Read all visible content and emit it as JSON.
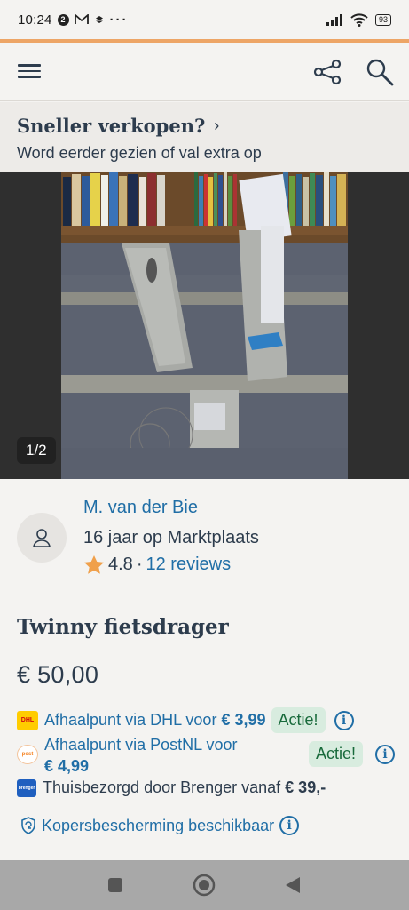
{
  "status": {
    "time": "10:24",
    "notif_count": "2",
    "battery": "93"
  },
  "colors": {
    "accent": "#eda566",
    "link": "#206ea6",
    "text": "#2d3c4d",
    "badge_bg": "#d8ecdf",
    "badge_text": "#186a3b",
    "star": "#f0a04b"
  },
  "promo": {
    "title": "Sneller verkopen?",
    "chevron": "›",
    "subtitle": "Word eerder gezien of val extra op"
  },
  "gallery": {
    "counter": "1/2"
  },
  "seller": {
    "name": "M. van der Bie",
    "years": "16 jaar op Marktplaats",
    "rating": "4.8",
    "separator": "·",
    "reviews": "12 reviews"
  },
  "listing": {
    "title": "Twinny fietsdrager",
    "price": "€ 50,00"
  },
  "shipping": [
    {
      "carrier": "DHL",
      "label": "Afhaalpunt via DHL voor ",
      "price": "€ 3,99",
      "badge": "Actie!"
    },
    {
      "carrier": "PostNL",
      "label": "Afhaalpunt via PostNL voor",
      "price": "€ 4,99",
      "badge": "Actie!"
    },
    {
      "carrier": "Brenger",
      "label": "Thuisbezorgd door Brenger vanaf ",
      "price": "€ 39,-"
    }
  ],
  "protection": {
    "label": "Kopersbescherming beschikbaar"
  },
  "icons": {
    "menu": "hamburger-icon",
    "share": "share-icon",
    "search": "search-icon",
    "info": "info-icon"
  }
}
